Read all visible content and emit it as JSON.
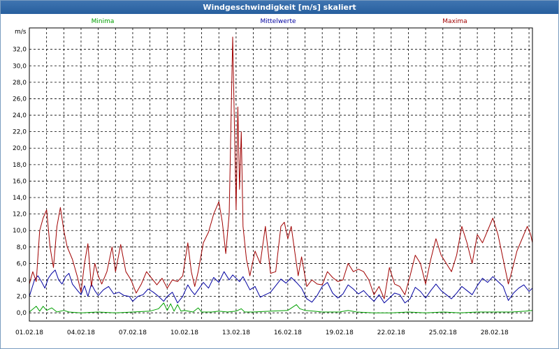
{
  "window": {
    "title": "Windgeschwindigkeit [m/s] skaliert"
  },
  "colors": {
    "minima": "#00a000",
    "mittelwerte": "#0000a0",
    "maxima": "#a00000",
    "grid": "#000000",
    "titlebar": "#2f66a6"
  },
  "chart_data": {
    "type": "line",
    "title": "Windgeschwindigkeit [m/s] skaliert",
    "ylabel": "m/s",
    "xlabel": "",
    "ylim": [
      -1.0,
      34.6
    ],
    "yticks": [
      "0,0",
      "2,0",
      "4,0",
      "6,0",
      "8,0",
      "10,0",
      "12,0",
      "14,0",
      "16,0",
      "18,0",
      "20,0",
      "22,0",
      "24,0",
      "26,0",
      "28,0",
      "30,0",
      "32,0"
    ],
    "xlim": [
      0,
      29.2
    ],
    "xticks": [
      {
        "day": 0,
        "label": "01.02.18"
      },
      {
        "day": 3,
        "label": "04.02.18"
      },
      {
        "day": 6,
        "label": "07.02.18"
      },
      {
        "day": 9,
        "label": "10.02.18"
      },
      {
        "day": 12,
        "label": "13.02.18"
      },
      {
        "day": 15,
        "label": "16.02.18"
      },
      {
        "day": 18,
        "label": "19.02.18"
      },
      {
        "day": 21,
        "label": "22.02.18"
      },
      {
        "day": 24,
        "label": "25.02.18"
      },
      {
        "day": 27,
        "label": "28.02.18"
      }
    ],
    "grid": true,
    "legend_position": "top",
    "series": [
      {
        "name": "Minima",
        "color": "#00a000",
        "points": [
          [
            0,
            0.1
          ],
          [
            0.4,
            0.8
          ],
          [
            0.6,
            0.2
          ],
          [
            0.8,
            0.8
          ],
          [
            1.0,
            0.3
          ],
          [
            1.3,
            0.6
          ],
          [
            1.6,
            0.1
          ],
          [
            2.0,
            0.3
          ],
          [
            2.3,
            0.1
          ],
          [
            3.0,
            0
          ],
          [
            4.0,
            0.1
          ],
          [
            5.0,
            0
          ],
          [
            6.0,
            0.1
          ],
          [
            7.0,
            0.2
          ],
          [
            7.5,
            0.5
          ],
          [
            7.8,
            1.2
          ],
          [
            8.0,
            0.3
          ],
          [
            8.2,
            1.1
          ],
          [
            8.4,
            0.2
          ],
          [
            8.6,
            1.0
          ],
          [
            8.8,
            0.2
          ],
          [
            9.0,
            0.3
          ],
          [
            9.5,
            0.1
          ],
          [
            9.8,
            0.6
          ],
          [
            10.0,
            0.1
          ],
          [
            10.6,
            0.1
          ],
          [
            11.0,
            0.2
          ],
          [
            11.5,
            0.1
          ],
          [
            12.0,
            0.2
          ],
          [
            12.3,
            0.5
          ],
          [
            12.5,
            0.1
          ],
          [
            13.0,
            0.1
          ],
          [
            14.0,
            0.2
          ],
          [
            15.0,
            0.3
          ],
          [
            15.5,
            1.0
          ],
          [
            15.7,
            0.5
          ],
          [
            16.0,
            0.3
          ],
          [
            16.5,
            0.2
          ],
          [
            17.0,
            0.1
          ],
          [
            18.0,
            0.1
          ],
          [
            18.5,
            0.3
          ],
          [
            19.0,
            0.1
          ],
          [
            20.0,
            0
          ],
          [
            21.0,
            0
          ],
          [
            22.0,
            0.1
          ],
          [
            23.0,
            0
          ],
          [
            24.0,
            0.1
          ],
          [
            25.0,
            0
          ],
          [
            26.0,
            0.1
          ],
          [
            27.0,
            0.1
          ],
          [
            28.0,
            0.1
          ],
          [
            28.8,
            0.2
          ],
          [
            29.2,
            0.3
          ]
        ]
      },
      {
        "name": "Mittelwerte",
        "color": "#0000a0",
        "points": [
          [
            0,
            2.0
          ],
          [
            0.3,
            4.0
          ],
          [
            0.5,
            4.5
          ],
          [
            0.7,
            3.8
          ],
          [
            0.9,
            3.0
          ],
          [
            1.1,
            4.2
          ],
          [
            1.3,
            4.8
          ],
          [
            1.5,
            5.2
          ],
          [
            1.7,
            4.0
          ],
          [
            1.9,
            3.5
          ],
          [
            2.1,
            4.4
          ],
          [
            2.3,
            4.8
          ],
          [
            2.5,
            3.5
          ],
          [
            2.8,
            2.7
          ],
          [
            3.0,
            2.2
          ],
          [
            3.2,
            3.3
          ],
          [
            3.4,
            2.0
          ],
          [
            3.6,
            3.5
          ],
          [
            3.8,
            2.7
          ],
          [
            4.0,
            2.1
          ],
          [
            4.3,
            2.8
          ],
          [
            4.6,
            3.2
          ],
          [
            4.9,
            2.3
          ],
          [
            5.2,
            2.5
          ],
          [
            5.5,
            2.1
          ],
          [
            5.8,
            2.0
          ],
          [
            6.0,
            1.4
          ],
          [
            6.3,
            2.0
          ],
          [
            6.6,
            2.2
          ],
          [
            6.9,
            2.9
          ],
          [
            7.2,
            2.5
          ],
          [
            7.5,
            2.0
          ],
          [
            7.8,
            1.4
          ],
          [
            8.0,
            2.0
          ],
          [
            8.3,
            2.5
          ],
          [
            8.6,
            1.2
          ],
          [
            8.9,
            2.0
          ],
          [
            9.2,
            3.4
          ],
          [
            9.4,
            2.7
          ],
          [
            9.6,
            2.2
          ],
          [
            9.8,
            2.8
          ],
          [
            10.1,
            3.7
          ],
          [
            10.4,
            3.0
          ],
          [
            10.7,
            4.3
          ],
          [
            11.0,
            3.7
          ],
          [
            11.3,
            5.0
          ],
          [
            11.6,
            4.0
          ],
          [
            11.8,
            4.6
          ],
          [
            12.0,
            4.2
          ],
          [
            12.2,
            3.8
          ],
          [
            12.4,
            4.4
          ],
          [
            12.6,
            3.6
          ],
          [
            12.8,
            2.8
          ],
          [
            13.1,
            3.2
          ],
          [
            13.4,
            1.9
          ],
          [
            13.7,
            2.2
          ],
          [
            14.0,
            2.5
          ],
          [
            14.3,
            3.3
          ],
          [
            14.6,
            4.1
          ],
          [
            14.9,
            3.6
          ],
          [
            15.2,
            4.3
          ],
          [
            15.5,
            3.7
          ],
          [
            15.8,
            3.0
          ],
          [
            16.1,
            1.7
          ],
          [
            16.4,
            1.3
          ],
          [
            16.7,
            2.1
          ],
          [
            17.0,
            3.2
          ],
          [
            17.3,
            3.7
          ],
          [
            17.6,
            2.4
          ],
          [
            17.9,
            1.8
          ],
          [
            18.2,
            2.3
          ],
          [
            18.5,
            3.4
          ],
          [
            18.8,
            2.9
          ],
          [
            19.1,
            2.3
          ],
          [
            19.4,
            2.7
          ],
          [
            19.7,
            2.0
          ],
          [
            20.0,
            1.4
          ],
          [
            20.3,
            2.2
          ],
          [
            20.6,
            1.2
          ],
          [
            20.9,
            1.8
          ],
          [
            21.2,
            2.4
          ],
          [
            21.5,
            2.2
          ],
          [
            21.8,
            1.2
          ],
          [
            22.1,
            1.7
          ],
          [
            22.4,
            3.1
          ],
          [
            22.7,
            2.6
          ],
          [
            23.0,
            1.8
          ],
          [
            23.3,
            2.7
          ],
          [
            23.6,
            3.5
          ],
          [
            23.9,
            2.7
          ],
          [
            24.2,
            2.2
          ],
          [
            24.5,
            1.7
          ],
          [
            24.8,
            2.4
          ],
          [
            25.1,
            3.2
          ],
          [
            25.4,
            2.7
          ],
          [
            25.7,
            2.2
          ],
          [
            26.0,
            3.3
          ],
          [
            26.3,
            4.2
          ],
          [
            26.6,
            3.7
          ],
          [
            26.9,
            4.4
          ],
          [
            27.2,
            3.8
          ],
          [
            27.5,
            3.2
          ],
          [
            27.8,
            1.5
          ],
          [
            28.1,
            2.4
          ],
          [
            28.4,
            3.0
          ],
          [
            28.7,
            3.4
          ],
          [
            29.0,
            2.6
          ],
          [
            29.2,
            3.0
          ]
        ]
      },
      {
        "name": "Maxima",
        "color": "#a00000",
        "points": [
          [
            0,
            3.5
          ],
          [
            0.2,
            5.0
          ],
          [
            0.4,
            3.8
          ],
          [
            0.6,
            10.0
          ],
          [
            0.8,
            11.5
          ],
          [
            1.0,
            12.5
          ],
          [
            1.2,
            8.0
          ],
          [
            1.4,
            5.5
          ],
          [
            1.6,
            10.5
          ],
          [
            1.8,
            12.8
          ],
          [
            2.0,
            10.0
          ],
          [
            2.2,
            8.0
          ],
          [
            2.5,
            6.5
          ],
          [
            2.8,
            4.3
          ],
          [
            3.0,
            2.5
          ],
          [
            3.2,
            6.0
          ],
          [
            3.4,
            8.4
          ],
          [
            3.6,
            3.2
          ],
          [
            3.8,
            6.0
          ],
          [
            4.0,
            4.5
          ],
          [
            4.2,
            3.5
          ],
          [
            4.5,
            5.0
          ],
          [
            4.8,
            8.0
          ],
          [
            5.0,
            5.0
          ],
          [
            5.3,
            8.3
          ],
          [
            5.6,
            5.0
          ],
          [
            5.9,
            4.0
          ],
          [
            6.2,
            2.4
          ],
          [
            6.5,
            3.5
          ],
          [
            6.8,
            5.0
          ],
          [
            7.1,
            4.2
          ],
          [
            7.4,
            3.4
          ],
          [
            7.7,
            4.2
          ],
          [
            8.0,
            3.0
          ],
          [
            8.3,
            4.0
          ],
          [
            8.6,
            3.8
          ],
          [
            8.9,
            4.5
          ],
          [
            9.2,
            8.5
          ],
          [
            9.4,
            5.0
          ],
          [
            9.6,
            3.2
          ],
          [
            9.8,
            5.0
          ],
          [
            10.1,
            8.5
          ],
          [
            10.4,
            9.8
          ],
          [
            10.7,
            12.0
          ],
          [
            11.0,
            13.5
          ],
          [
            11.2,
            11.0
          ],
          [
            11.4,
            7.2
          ],
          [
            11.6,
            12.0
          ],
          [
            11.8,
            33.5
          ],
          [
            12.0,
            12.5
          ],
          [
            12.1,
            25.0
          ],
          [
            12.2,
            15.0
          ],
          [
            12.3,
            22.0
          ],
          [
            12.4,
            10.5
          ],
          [
            12.6,
            6.5
          ],
          [
            12.8,
            4.5
          ],
          [
            13.1,
            7.5
          ],
          [
            13.4,
            6.0
          ],
          [
            13.7,
            10.5
          ],
          [
            14.0,
            4.8
          ],
          [
            14.3,
            5.0
          ],
          [
            14.6,
            10.5
          ],
          [
            14.8,
            11.0
          ],
          [
            15.0,
            9.0
          ],
          [
            15.2,
            10.5
          ],
          [
            15.4,
            7.5
          ],
          [
            15.6,
            4.5
          ],
          [
            15.8,
            6.8
          ],
          [
            16.1,
            3.2
          ],
          [
            16.4,
            4.0
          ],
          [
            16.7,
            3.5
          ],
          [
            17.0,
            3.4
          ],
          [
            17.3,
            5.0
          ],
          [
            17.6,
            4.3
          ],
          [
            17.9,
            3.8
          ],
          [
            18.2,
            4.0
          ],
          [
            18.5,
            6.0
          ],
          [
            18.8,
            5.0
          ],
          [
            19.1,
            5.3
          ],
          [
            19.4,
            5.0
          ],
          [
            19.7,
            4.0
          ],
          [
            20.0,
            2.2
          ],
          [
            20.3,
            3.2
          ],
          [
            20.6,
            1.7
          ],
          [
            20.9,
            5.5
          ],
          [
            21.2,
            3.5
          ],
          [
            21.5,
            3.2
          ],
          [
            21.8,
            2.2
          ],
          [
            22.1,
            4.5
          ],
          [
            22.4,
            7.0
          ],
          [
            22.7,
            6.0
          ],
          [
            23.0,
            3.5
          ],
          [
            23.3,
            6.5
          ],
          [
            23.6,
            9.0
          ],
          [
            23.9,
            7.0
          ],
          [
            24.2,
            6.0
          ],
          [
            24.5,
            5.0
          ],
          [
            24.8,
            7.0
          ],
          [
            25.1,
            10.5
          ],
          [
            25.4,
            8.5
          ],
          [
            25.7,
            6.0
          ],
          [
            26.0,
            9.5
          ],
          [
            26.3,
            8.5
          ],
          [
            26.6,
            10.0
          ],
          [
            26.9,
            11.5
          ],
          [
            27.2,
            9.5
          ],
          [
            27.5,
            6.5
          ],
          [
            27.8,
            3.5
          ],
          [
            28.0,
            5.0
          ],
          [
            28.3,
            7.5
          ],
          [
            28.6,
            9.0
          ],
          [
            28.9,
            10.5
          ],
          [
            29.1,
            9.5
          ],
          [
            29.2,
            8.5
          ]
        ]
      }
    ]
  }
}
